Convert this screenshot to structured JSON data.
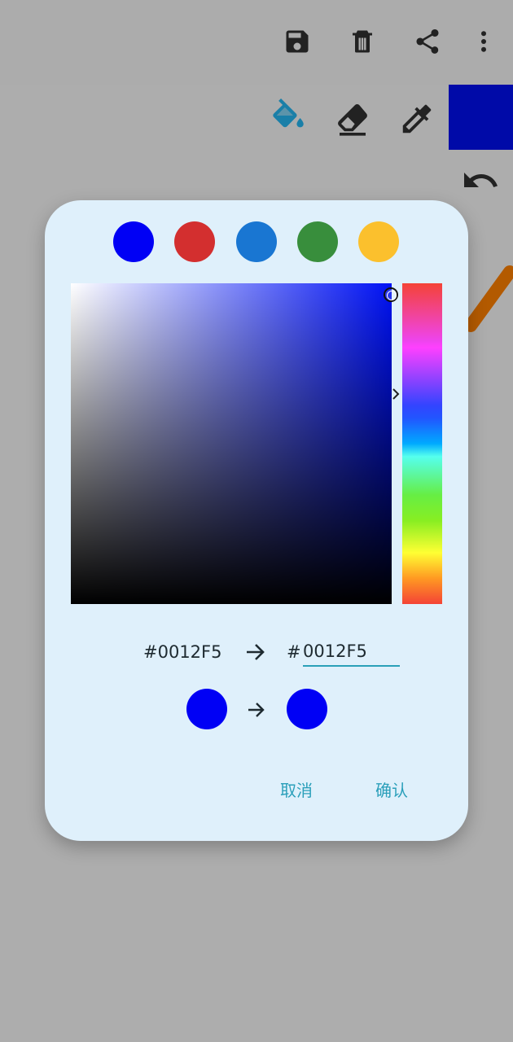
{
  "app_bar": {
    "icons": [
      "save-icon",
      "trash-icon",
      "share-icon",
      "more-vert-icon"
    ]
  },
  "tools": {
    "icons": [
      "fill-bucket-icon",
      "eraser-icon",
      "eyedropper-icon"
    ],
    "active_tool_color": "#1a7fa8",
    "current_color": "#000aa8"
  },
  "undo_icon": "undo-icon",
  "canvas": {
    "stroke_color": "#b35a00"
  },
  "color_picker": {
    "presets": [
      {
        "color": "#0000f5"
      },
      {
        "color": "#d32f2f"
      },
      {
        "color": "#1976d2"
      },
      {
        "color": "#388e3c"
      },
      {
        "color": "#fbc02d"
      }
    ],
    "hue_color": "#0012f5",
    "old_hex": "#0012F5",
    "hash_prefix": "#",
    "new_hex": "0012F5",
    "old_color": "#0000f5",
    "new_color": "#0000f5",
    "cancel_label": "取消",
    "confirm_label": "确认"
  }
}
